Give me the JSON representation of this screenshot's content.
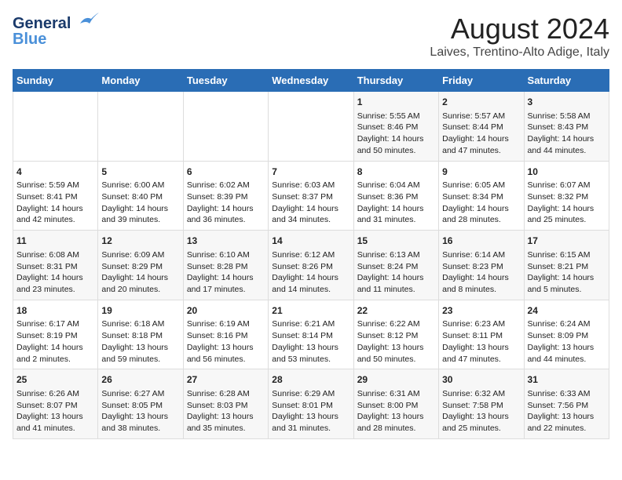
{
  "header": {
    "logo_line1": "General",
    "logo_line2": "Blue",
    "month_title": "August 2024",
    "location": "Laives, Trentino-Alto Adige, Italy"
  },
  "days_of_week": [
    "Sunday",
    "Monday",
    "Tuesday",
    "Wednesday",
    "Thursday",
    "Friday",
    "Saturday"
  ],
  "weeks": [
    [
      {
        "day": "",
        "content": ""
      },
      {
        "day": "",
        "content": ""
      },
      {
        "day": "",
        "content": ""
      },
      {
        "day": "",
        "content": ""
      },
      {
        "day": "1",
        "content": "Sunrise: 5:55 AM\nSunset: 8:46 PM\nDaylight: 14 hours and 50 minutes."
      },
      {
        "day": "2",
        "content": "Sunrise: 5:57 AM\nSunset: 8:44 PM\nDaylight: 14 hours and 47 minutes."
      },
      {
        "day": "3",
        "content": "Sunrise: 5:58 AM\nSunset: 8:43 PM\nDaylight: 14 hours and 44 minutes."
      }
    ],
    [
      {
        "day": "4",
        "content": "Sunrise: 5:59 AM\nSunset: 8:41 PM\nDaylight: 14 hours and 42 minutes."
      },
      {
        "day": "5",
        "content": "Sunrise: 6:00 AM\nSunset: 8:40 PM\nDaylight: 14 hours and 39 minutes."
      },
      {
        "day": "6",
        "content": "Sunrise: 6:02 AM\nSunset: 8:39 PM\nDaylight: 14 hours and 36 minutes."
      },
      {
        "day": "7",
        "content": "Sunrise: 6:03 AM\nSunset: 8:37 PM\nDaylight: 14 hours and 34 minutes."
      },
      {
        "day": "8",
        "content": "Sunrise: 6:04 AM\nSunset: 8:36 PM\nDaylight: 14 hours and 31 minutes."
      },
      {
        "day": "9",
        "content": "Sunrise: 6:05 AM\nSunset: 8:34 PM\nDaylight: 14 hours and 28 minutes."
      },
      {
        "day": "10",
        "content": "Sunrise: 6:07 AM\nSunset: 8:32 PM\nDaylight: 14 hours and 25 minutes."
      }
    ],
    [
      {
        "day": "11",
        "content": "Sunrise: 6:08 AM\nSunset: 8:31 PM\nDaylight: 14 hours and 23 minutes."
      },
      {
        "day": "12",
        "content": "Sunrise: 6:09 AM\nSunset: 8:29 PM\nDaylight: 14 hours and 20 minutes."
      },
      {
        "day": "13",
        "content": "Sunrise: 6:10 AM\nSunset: 8:28 PM\nDaylight: 14 hours and 17 minutes."
      },
      {
        "day": "14",
        "content": "Sunrise: 6:12 AM\nSunset: 8:26 PM\nDaylight: 14 hours and 14 minutes."
      },
      {
        "day": "15",
        "content": "Sunrise: 6:13 AM\nSunset: 8:24 PM\nDaylight: 14 hours and 11 minutes."
      },
      {
        "day": "16",
        "content": "Sunrise: 6:14 AM\nSunset: 8:23 PM\nDaylight: 14 hours and 8 minutes."
      },
      {
        "day": "17",
        "content": "Sunrise: 6:15 AM\nSunset: 8:21 PM\nDaylight: 14 hours and 5 minutes."
      }
    ],
    [
      {
        "day": "18",
        "content": "Sunrise: 6:17 AM\nSunset: 8:19 PM\nDaylight: 14 hours and 2 minutes."
      },
      {
        "day": "19",
        "content": "Sunrise: 6:18 AM\nSunset: 8:18 PM\nDaylight: 13 hours and 59 minutes."
      },
      {
        "day": "20",
        "content": "Sunrise: 6:19 AM\nSunset: 8:16 PM\nDaylight: 13 hours and 56 minutes."
      },
      {
        "day": "21",
        "content": "Sunrise: 6:21 AM\nSunset: 8:14 PM\nDaylight: 13 hours and 53 minutes."
      },
      {
        "day": "22",
        "content": "Sunrise: 6:22 AM\nSunset: 8:12 PM\nDaylight: 13 hours and 50 minutes."
      },
      {
        "day": "23",
        "content": "Sunrise: 6:23 AM\nSunset: 8:11 PM\nDaylight: 13 hours and 47 minutes."
      },
      {
        "day": "24",
        "content": "Sunrise: 6:24 AM\nSunset: 8:09 PM\nDaylight: 13 hours and 44 minutes."
      }
    ],
    [
      {
        "day": "25",
        "content": "Sunrise: 6:26 AM\nSunset: 8:07 PM\nDaylight: 13 hours and 41 minutes."
      },
      {
        "day": "26",
        "content": "Sunrise: 6:27 AM\nSunset: 8:05 PM\nDaylight: 13 hours and 38 minutes."
      },
      {
        "day": "27",
        "content": "Sunrise: 6:28 AM\nSunset: 8:03 PM\nDaylight: 13 hours and 35 minutes."
      },
      {
        "day": "28",
        "content": "Sunrise: 6:29 AM\nSunset: 8:01 PM\nDaylight: 13 hours and 31 minutes."
      },
      {
        "day": "29",
        "content": "Sunrise: 6:31 AM\nSunset: 8:00 PM\nDaylight: 13 hours and 28 minutes."
      },
      {
        "day": "30",
        "content": "Sunrise: 6:32 AM\nSunset: 7:58 PM\nDaylight: 13 hours and 25 minutes."
      },
      {
        "day": "31",
        "content": "Sunrise: 6:33 AM\nSunset: 7:56 PM\nDaylight: 13 hours and 22 minutes."
      }
    ]
  ]
}
